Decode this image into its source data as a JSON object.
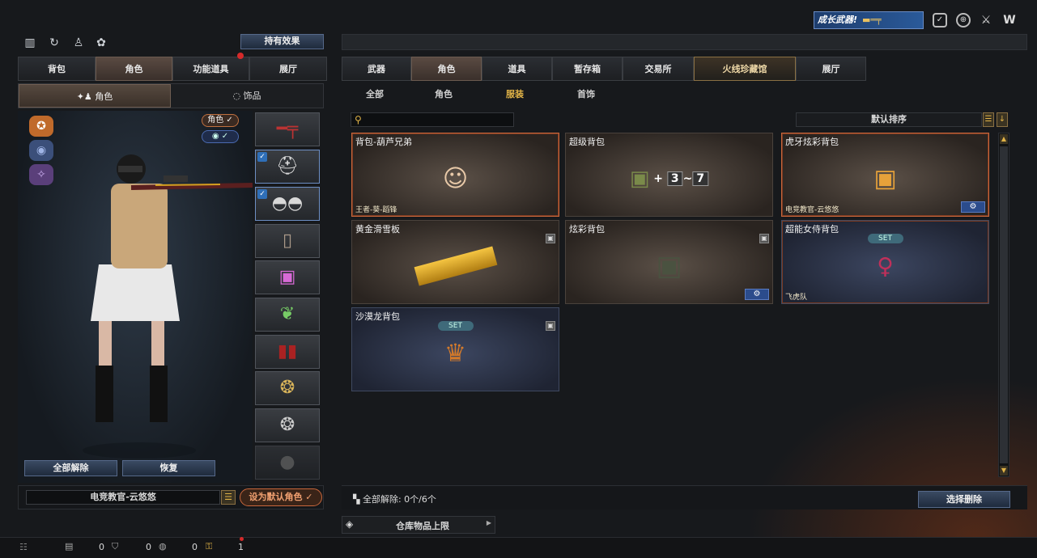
{
  "top_right": {
    "banner": "成长武器!"
  },
  "left": {
    "effects_button": "持有效果",
    "tabs": [
      {
        "label": "背包"
      },
      {
        "label": "角色"
      },
      {
        "label": "功能道具"
      },
      {
        "label": "展厅"
      }
    ],
    "subtabs": [
      {
        "label": "角色"
      },
      {
        "label": "饰品"
      }
    ],
    "toggle_role": "角色",
    "btn_unequip_all": "全部解除",
    "btn_restore": "恢复",
    "char_name": "电竞教官-云悠悠",
    "btn_set_default": "设为默认角色"
  },
  "right": {
    "tabs": [
      {
        "label": "武器"
      },
      {
        "label": "角色"
      },
      {
        "label": "道具"
      },
      {
        "label": "暂存箱"
      },
      {
        "label": "交易所"
      },
      {
        "label": "火线珍藏馆"
      },
      {
        "label": "展厅"
      }
    ],
    "subtabs": [
      {
        "label": "全部"
      },
      {
        "label": "角色"
      },
      {
        "label": "服装"
      },
      {
        "label": "首饰"
      }
    ],
    "search": {
      "placeholder": ""
    },
    "sort_label": "默认排序",
    "items": [
      {
        "name": "背包-葫芦兄弟",
        "sub": "王者-葵-蹈锋"
      },
      {
        "name": "超级背包",
        "combo_a": "3",
        "combo_b": "7"
      },
      {
        "name": "虎牙炫彩背包",
        "sub": "电竞教官-云悠悠"
      },
      {
        "name": "黄金滑雪板"
      },
      {
        "name": "炫彩背包"
      },
      {
        "name": "超能女侍背包",
        "set": "SET",
        "sub": "飞虎队"
      },
      {
        "name": "沙漠龙背包",
        "set": "SET"
      }
    ],
    "unequip_status": "全部解除: 0个/6个",
    "btn_select_remove": "选择删除",
    "warehouse_label": "仓库物品上限"
  },
  "bottom": {
    "count1": "0",
    "count2": "0",
    "count3": "0",
    "count4": "1"
  },
  "colors": {
    "accent_orange": "#c9673b",
    "blue_button": "#2b4c8c",
    "gold": "#e1b347"
  }
}
